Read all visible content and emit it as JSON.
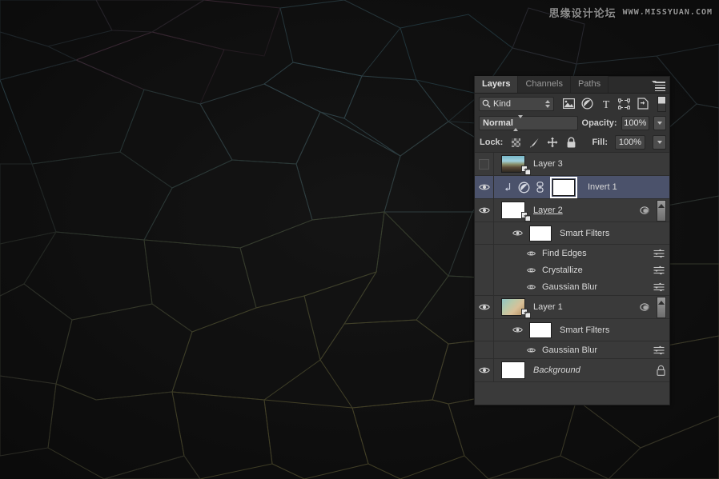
{
  "watermark": {
    "cn_text": "思缘设计论坛",
    "url_text": "WWW.MISSYUAN.COM"
  },
  "panel": {
    "tabs": [
      {
        "label": "Layers",
        "active": true
      },
      {
        "label": "Channels",
        "active": false
      },
      {
        "label": "Paths",
        "active": false
      }
    ],
    "menu_icon": "panel-menu-icon",
    "filter": {
      "search_icon": "search-icon",
      "kind_label": "Kind",
      "icons": [
        {
          "name": "pixel-layer-filter-icon"
        },
        {
          "name": "adjustment-layer-filter-icon"
        },
        {
          "name": "type-layer-filter-icon"
        },
        {
          "name": "shape-layer-filter-icon"
        },
        {
          "name": "smart-object-filter-icon"
        }
      ],
      "toggle_name": "filter-enable-toggle"
    },
    "blend": {
      "mode": "Normal",
      "opacity_label": "Opacity:",
      "opacity_value": "100%"
    },
    "lock": {
      "label": "Lock:",
      "icons": [
        {
          "name": "lock-transparent-pixels-icon"
        },
        {
          "name": "lock-image-pixels-icon"
        },
        {
          "name": "lock-position-icon"
        },
        {
          "name": "lock-all-icon"
        }
      ],
      "fill_label": "Fill:",
      "fill_value": "100%"
    }
  },
  "layers": [
    {
      "id": "layer-3",
      "name": "Layer 3",
      "visible": false,
      "selected": false,
      "thumb_type": "photo",
      "smart_object": true,
      "italic": false,
      "underline": false
    },
    {
      "id": "invert-1",
      "name": "Invert 1",
      "visible": true,
      "selected": true,
      "thumb_type": "mask-white",
      "clipped": true,
      "adjustment_icon": "invert-adjustment-icon",
      "link_icon": "mask-link-icon",
      "mask_selected": true
    },
    {
      "id": "layer-2",
      "name": "Layer 2",
      "visible": true,
      "selected": false,
      "thumb_type": "white",
      "smart_object": true,
      "underline": true,
      "has_fx": true,
      "collapse": true,
      "smart_filters": {
        "label": "Smart Filters",
        "visible": true,
        "filters": [
          {
            "name": "Find Edges",
            "visible": true
          },
          {
            "name": "Crystallize",
            "visible": true
          },
          {
            "name": "Gaussian Blur",
            "visible": true
          }
        ]
      }
    },
    {
      "id": "layer-1",
      "name": "Layer 1",
      "visible": true,
      "selected": false,
      "thumb_type": "gradient",
      "smart_object": true,
      "has_fx": true,
      "collapse": true,
      "smart_filters": {
        "label": "Smart Filters",
        "visible": true,
        "filters": [
          {
            "name": "Gaussian Blur",
            "visible": true
          }
        ]
      }
    },
    {
      "id": "background",
      "name": "Background",
      "visible": true,
      "selected": false,
      "thumb_type": "white",
      "italic": true,
      "locked": true
    }
  ],
  "colors": {
    "panel_bg": "#333333",
    "list_bg": "#3a3a3a",
    "selected_row": "#4b526b",
    "text": "#d8d8d8",
    "tab_active_bg": "#3a3a3a",
    "canvas_bg": "#161616"
  }
}
